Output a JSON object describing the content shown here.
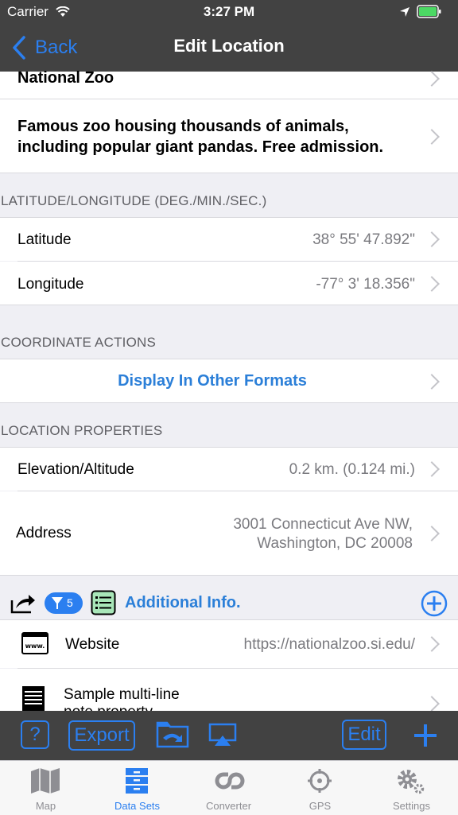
{
  "status": {
    "carrier": "Carrier",
    "time": "3:27 PM"
  },
  "nav": {
    "back_label": "Back",
    "title": "Edit Location"
  },
  "place": {
    "name": "National Zoo",
    "description_line1": "Famous zoo housing thousands of animals,",
    "description_line2": "including popular giant pandas. Free admission."
  },
  "latlon": {
    "header": "LATITUDE/LONGITUDE (DEG./MIN./SEC.)",
    "latitude_label": "Latitude",
    "latitude_value": "38° 55' 47.892\"",
    "longitude_label": "Longitude",
    "longitude_value": "-77° 3' 18.356\""
  },
  "coord_actions": {
    "header": "COORDINATE ACTIONS",
    "display_other": "Display In Other Formats"
  },
  "location_props": {
    "header": "LOCATION PROPERTIES",
    "elevation_label": "Elevation/Altitude",
    "elevation_value": "0.2 km. (0.124 mi.)",
    "address_label": "Address",
    "address_line1": "3001 Connecticut Ave NW,",
    "address_line2": "Washington, DC 20008"
  },
  "additional": {
    "filter_count": "5",
    "title": "Additional Info.",
    "website_label": "Website",
    "website_value": "https://nationalzoo.si.edu/",
    "notes_line1": "Sample multi-line",
    "notes_line2": "note property"
  },
  "toolbar": {
    "export_label": "Export",
    "edit_label": "Edit",
    "help_label": "?"
  },
  "tabs": [
    {
      "label": "Map",
      "icon": "map-icon"
    },
    {
      "label": "Data Sets",
      "icon": "data-sets-icon"
    },
    {
      "label": "Converter",
      "icon": "converter-icon"
    },
    {
      "label": "GPS",
      "icon": "gps-icon"
    },
    {
      "label": "Settings",
      "icon": "gear-icon"
    }
  ],
  "colors": {
    "accent": "#2b7ff0",
    "bar": "#424242",
    "group_bg": "#efeff4"
  }
}
